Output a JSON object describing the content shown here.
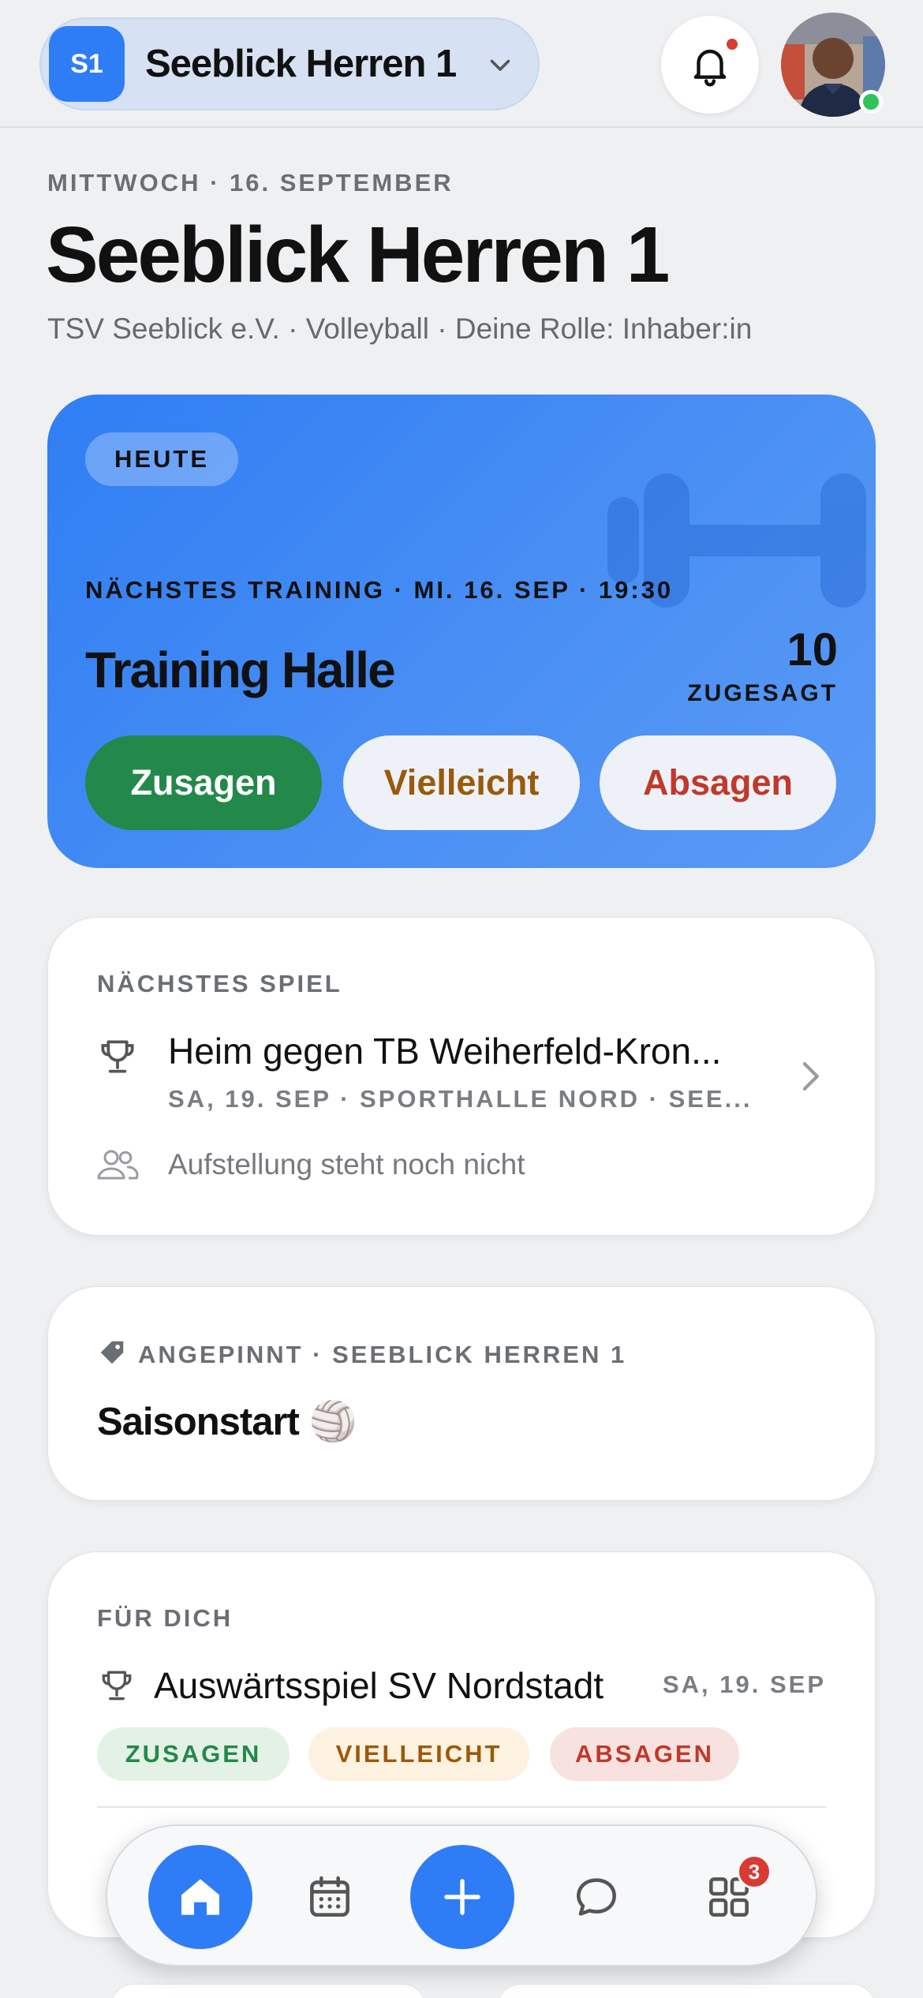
{
  "header": {
    "team_badge": "S1",
    "team_name": "Seeblick Herren 1",
    "has_notification": true
  },
  "intro": {
    "date": "MITTWOCH · 16. SEPTEMBER",
    "title": "Seeblick Herren 1",
    "subtitle": "TSV Seeblick e.V. · Volleyball · Deine Rolle: Inhaber:in"
  },
  "hero": {
    "chip": "HEUTE",
    "label": "NÄCHSTES TRAINING · MI. 16. SEP · 19:30",
    "title": "Training Halle",
    "count": "10",
    "count_label": "ZUGESAGT",
    "buttons": {
      "yes": "Zusagen",
      "maybe": "Vielleicht",
      "no": "Absagen"
    }
  },
  "next_game": {
    "label": "NÄCHSTES SPIEL",
    "title": "Heim gegen TB Weiherfeld-Kron...",
    "meta": "SA, 19. SEP · SPORTHALLE NORD · SEE...",
    "lineup": "Aufstellung steht noch nicht"
  },
  "pinned": {
    "label": "ANGEPINNT · SEEBLICK HERREN 1",
    "title": "Saisonstart 🏐"
  },
  "for_you": {
    "label": "FÜR DICH",
    "title": "Auswärtsspiel SV Nordstadt",
    "date": "SA, 19. SEP",
    "chips": {
      "yes": "ZUSAGEN",
      "maybe": "VIELLEICHT",
      "no": "ABSAGEN"
    }
  },
  "tabbar": {
    "badge": "3",
    "active": "home"
  },
  "colors": {
    "accent": "#2f7df6",
    "success": "#22894a",
    "warning": "#9a5a0b",
    "danger": "#c0392b",
    "background": "#eff0f2"
  }
}
